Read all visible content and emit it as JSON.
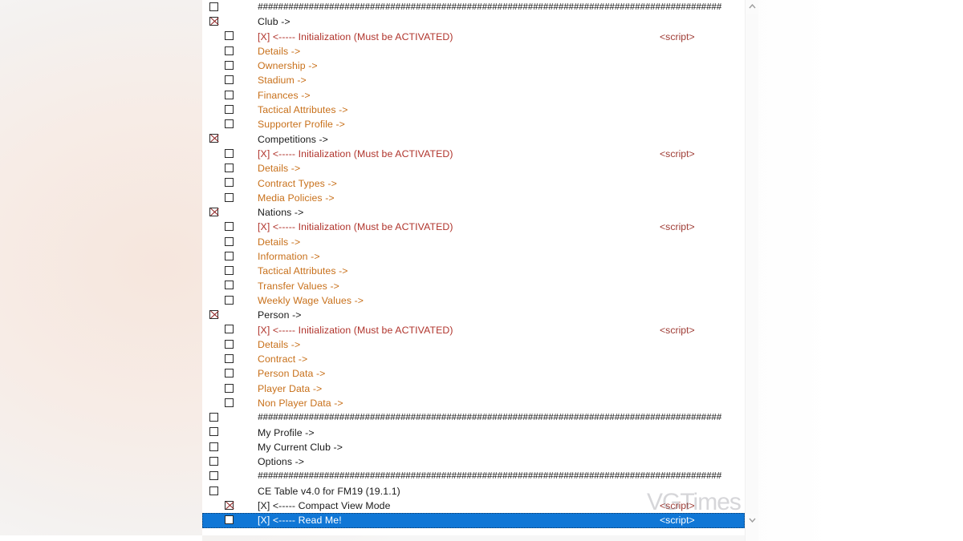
{
  "app": {
    "watermark": "VGTimes",
    "script_tag_label": "<script>",
    "divider_text": "###########################################################################################"
  },
  "scrollbar": {
    "up_arrow": "chevron-up-icon",
    "down_arrow": "chevron-down-icon"
  },
  "tree": {
    "rows": [
      {
        "indent": 0,
        "checked": false,
        "style": "hash",
        "label": "###########################################################################################",
        "script": false,
        "selected": false
      },
      {
        "indent": 0,
        "checked": true,
        "style": "dark",
        "label": "Club ->",
        "script": false,
        "selected": false
      },
      {
        "indent": 1,
        "checked": false,
        "style": "red",
        "label": "[X] <----- Initialization (Must be ACTIVATED)",
        "script": true,
        "selected": false
      },
      {
        "indent": 1,
        "checked": false,
        "style": "orange",
        "label": "Details ->",
        "script": false,
        "selected": false
      },
      {
        "indent": 1,
        "checked": false,
        "style": "orange",
        "label": "Ownership ->",
        "script": false,
        "selected": false
      },
      {
        "indent": 1,
        "checked": false,
        "style": "orange",
        "label": "Stadium ->",
        "script": false,
        "selected": false
      },
      {
        "indent": 1,
        "checked": false,
        "style": "orange",
        "label": "Finances ->",
        "script": false,
        "selected": false
      },
      {
        "indent": 1,
        "checked": false,
        "style": "orange",
        "label": "Tactical Attributes ->",
        "script": false,
        "selected": false
      },
      {
        "indent": 1,
        "checked": false,
        "style": "orange",
        "label": "Supporter Profile ->",
        "script": false,
        "selected": false
      },
      {
        "indent": 0,
        "checked": true,
        "style": "dark",
        "label": "Competitions ->",
        "script": false,
        "selected": false
      },
      {
        "indent": 1,
        "checked": false,
        "style": "red",
        "label": "[X] <----- Initialization (Must be ACTIVATED)",
        "script": true,
        "selected": false
      },
      {
        "indent": 1,
        "checked": false,
        "style": "orange",
        "label": "Details ->",
        "script": false,
        "selected": false
      },
      {
        "indent": 1,
        "checked": false,
        "style": "orange",
        "label": "Contract Types ->",
        "script": false,
        "selected": false
      },
      {
        "indent": 1,
        "checked": false,
        "style": "orange",
        "label": "Media Policies ->",
        "script": false,
        "selected": false
      },
      {
        "indent": 0,
        "checked": true,
        "style": "dark",
        "label": "Nations ->",
        "script": false,
        "selected": false
      },
      {
        "indent": 1,
        "checked": false,
        "style": "red",
        "label": "[X] <----- Initialization (Must be ACTIVATED)",
        "script": true,
        "selected": false
      },
      {
        "indent": 1,
        "checked": false,
        "style": "orange",
        "label": "Details ->",
        "script": false,
        "selected": false
      },
      {
        "indent": 1,
        "checked": false,
        "style": "orange",
        "label": "Information ->",
        "script": false,
        "selected": false
      },
      {
        "indent": 1,
        "checked": false,
        "style": "orange",
        "label": "Tactical Attributes ->",
        "script": false,
        "selected": false
      },
      {
        "indent": 1,
        "checked": false,
        "style": "orange",
        "label": "Transfer Values ->",
        "script": false,
        "selected": false
      },
      {
        "indent": 1,
        "checked": false,
        "style": "orange",
        "label": "Weekly Wage Values ->",
        "script": false,
        "selected": false
      },
      {
        "indent": 0,
        "checked": true,
        "style": "dark",
        "label": "Person ->",
        "script": false,
        "selected": false
      },
      {
        "indent": 1,
        "checked": false,
        "style": "red",
        "label": "[X] <----- Initialization (Must be ACTIVATED)",
        "script": true,
        "selected": false
      },
      {
        "indent": 1,
        "checked": false,
        "style": "orange",
        "label": "Details ->",
        "script": false,
        "selected": false
      },
      {
        "indent": 1,
        "checked": false,
        "style": "orange",
        "label": "Contract ->",
        "script": false,
        "selected": false
      },
      {
        "indent": 1,
        "checked": false,
        "style": "orange",
        "label": "Person Data ->",
        "script": false,
        "selected": false
      },
      {
        "indent": 1,
        "checked": false,
        "style": "orange",
        "label": "Player Data ->",
        "script": false,
        "selected": false
      },
      {
        "indent": 1,
        "checked": false,
        "style": "orange",
        "label": "Non Player Data ->",
        "script": false,
        "selected": false
      },
      {
        "indent": 0,
        "checked": false,
        "style": "hash",
        "label": "###########################################################################################",
        "script": false,
        "selected": false
      },
      {
        "indent": 0,
        "checked": false,
        "style": "dark",
        "label": "My Profile ->",
        "script": false,
        "selected": false
      },
      {
        "indent": 0,
        "checked": false,
        "style": "dark",
        "label": "My Current Club ->",
        "script": false,
        "selected": false
      },
      {
        "indent": 0,
        "checked": false,
        "style": "dark",
        "label": "Options ->",
        "script": false,
        "selected": false
      },
      {
        "indent": 0,
        "checked": false,
        "style": "hash",
        "label": "###########################################################################################",
        "script": false,
        "selected": false
      },
      {
        "indent": 0,
        "checked": false,
        "style": "dark",
        "label": "CE Table v4.0 for FM19 (19.1.1)",
        "script": false,
        "selected": false
      },
      {
        "indent": 1,
        "checked": true,
        "style": "dark",
        "label": "[X] <----- Compact View Mode",
        "script": true,
        "selected": false
      },
      {
        "indent": 1,
        "checked": false,
        "style": "white",
        "label": "[X] <----- Read Me!",
        "script": true,
        "selected": true
      }
    ]
  }
}
